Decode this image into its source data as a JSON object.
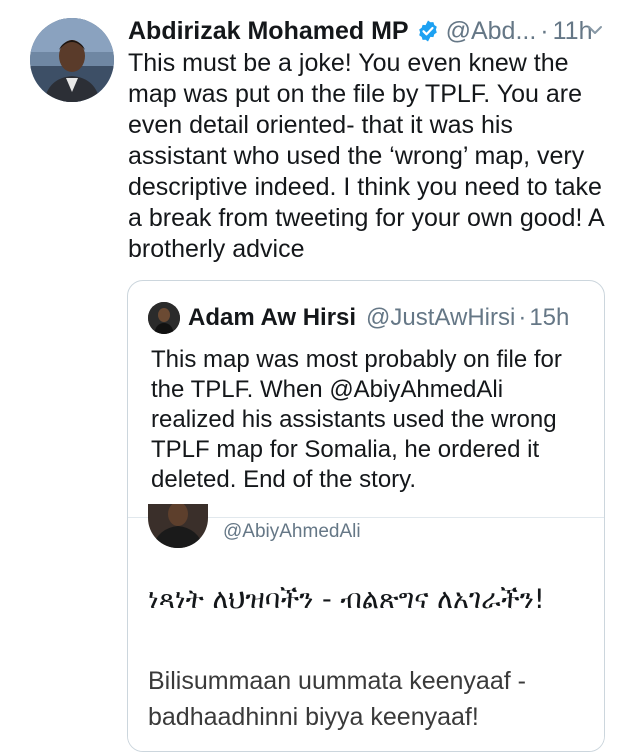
{
  "tweet": {
    "display_name": "Abdirizak Mohamed MP",
    "handle": "@Abd...",
    "separator": "·",
    "time": "11h",
    "text": "This must be a joke! You even knew the map was put on the file by TPLF. You are even detail oriented- that it was his assistant who used the ‘wrong’ map, very descriptive indeed. I think you need to take a break  from tweeting for your own good! A brotherly advice",
    "verified_icon": "verified-badge-icon",
    "menu_icon": "chevron-down-icon"
  },
  "quoted": {
    "display_name": "Adam Aw Hirsi",
    "handle": "@JustAwHirsi",
    "separator": "·",
    "time": "15h",
    "text": "This map was most probably on file for the TPLF. When @AbiyAhmedAli realized his assistants used the wrong TPLF map for Somalia, he ordered it deleted. End of the story."
  },
  "embedded": {
    "handle": "@AbiyAhmedAli",
    "amharic_text": "ነጻነት ለህዝባችን - ብልጽግና ለአገራችን!",
    "oromo_text": "Bilisummaan uummata keenyaaf - badhaadhinni biyya keenyaaf!"
  },
  "colors": {
    "text": "#14171a",
    "secondary": "#657786",
    "verified_blue": "#1da1f2",
    "border": "#ccd6dd"
  }
}
